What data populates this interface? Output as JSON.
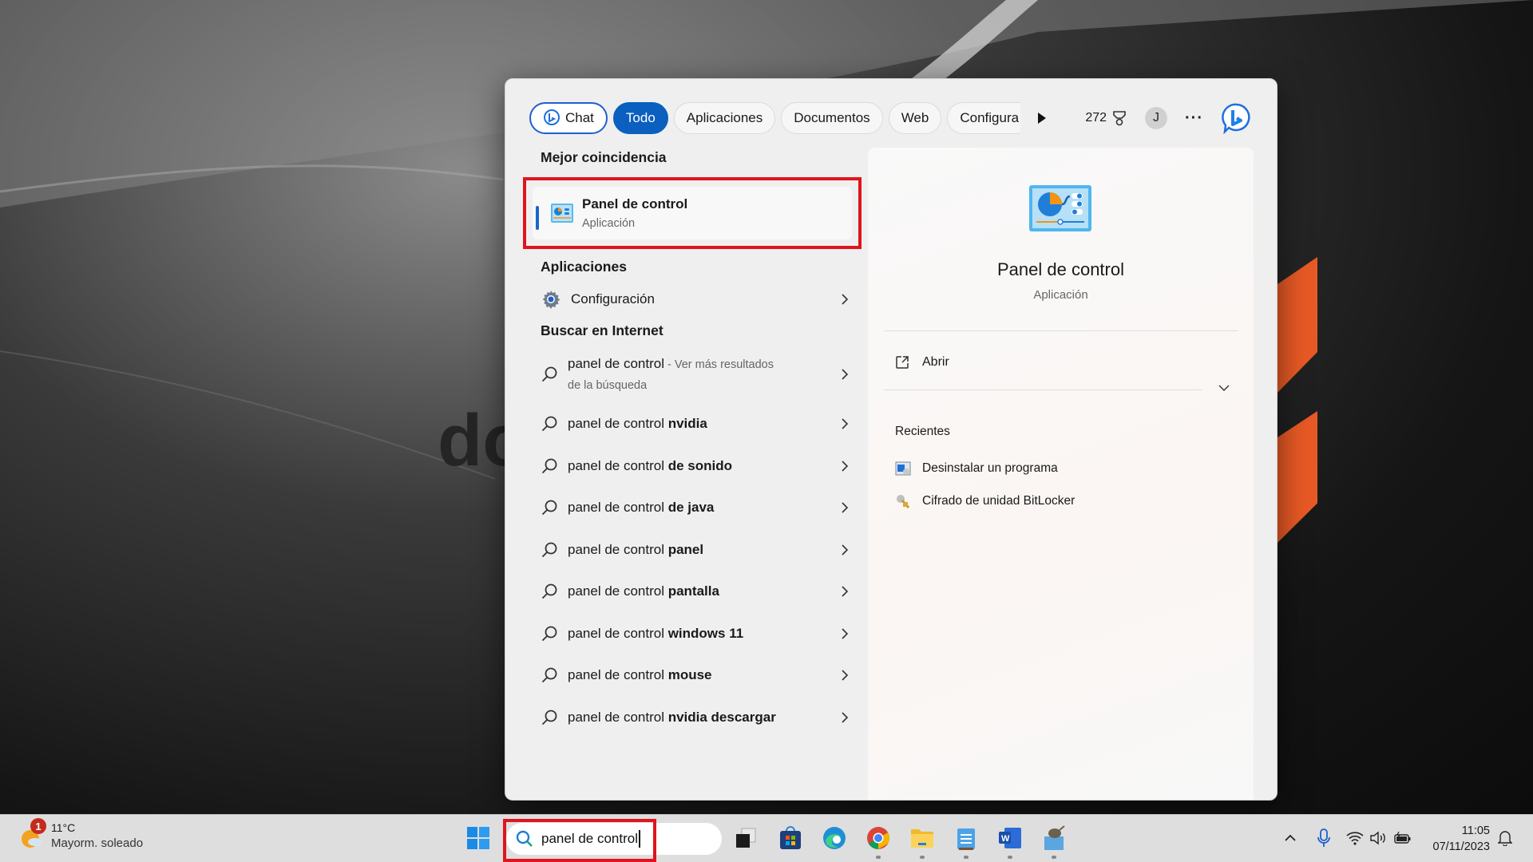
{
  "search_panel": {
    "tabs": [
      {
        "label": "Chat",
        "icon": "bing-chat-icon"
      },
      {
        "label": "Todo",
        "active": true
      },
      {
        "label": "Aplicaciones"
      },
      {
        "label": "Documentos"
      },
      {
        "label": "Web"
      },
      {
        "label": "Configura"
      }
    ],
    "rewards_points": "272",
    "avatar_initial": "J",
    "more_label": "···",
    "best_match": {
      "heading": "Mejor coincidencia",
      "title": "Panel de control",
      "subtitle": "Aplicación"
    },
    "apps": {
      "heading": "Aplicaciones",
      "items": [
        {
          "label": "Configuración"
        }
      ]
    },
    "web": {
      "heading": "Buscar en Internet",
      "first": {
        "query": "panel de control",
        "suffix": " - Ver más resultados",
        "line2": "de la búsqueda"
      },
      "suggestions": [
        {
          "prefix": "panel de control ",
          "bold": "nvidia"
        },
        {
          "prefix": "panel de control ",
          "bold": "de sonido"
        },
        {
          "prefix": "panel de control ",
          "bold": "de java"
        },
        {
          "prefix": "panel de control ",
          "bold": "panel"
        },
        {
          "prefix": "panel de control ",
          "bold": "pantalla"
        },
        {
          "prefix": "panel de control ",
          "bold": "windows 11"
        },
        {
          "prefix": "panel de control ",
          "bold": "mouse"
        },
        {
          "prefix": "panel de control ",
          "bold": "nvidia descargar"
        }
      ]
    },
    "preview": {
      "title": "Panel de control",
      "subtitle": "Aplicación",
      "action_open": "Abrir",
      "recent_heading": "Recientes",
      "recent": [
        {
          "label": "Desinstalar un programa"
        },
        {
          "label": "Cifrado de unidad BitLocker"
        }
      ]
    }
  },
  "taskbar": {
    "weather": {
      "temp": "11°C",
      "condition": "Mayorm. soleado",
      "badge": "1"
    },
    "search_value": "panel de control",
    "clock": {
      "time": "11:05",
      "date": "07/11/2023"
    },
    "accent": "#0a5fbf",
    "highlight_color": "#e0141d"
  },
  "background": {
    "partial_text": "do"
  }
}
